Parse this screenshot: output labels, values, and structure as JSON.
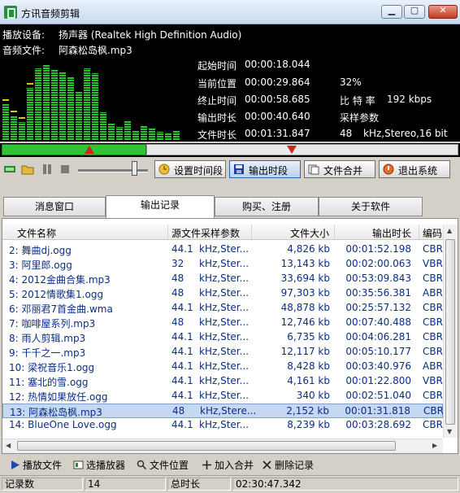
{
  "window": {
    "title": "方讯音频剪辑"
  },
  "player": {
    "device_label": "播放设备:",
    "device_value": "扬声器 (Realtek High Definition Audio)",
    "file_label": "音频文件:",
    "file_value": "阿森松岛枫.mp3",
    "start_time_label": "起始时间",
    "start_time": "00:00:18.044",
    "current_pos_label": "当前位置",
    "current_pos": "00:00:29.864",
    "end_time_label": "终止时间",
    "end_time": "00:00:58.685",
    "output_duration_label": "输出时长",
    "output_duration": "00:00:40.640",
    "file_duration_label": "文件时长",
    "file_duration": "00:01:31.847",
    "percent": "32%",
    "bitrate_label": "比 特 率",
    "bitrate_value": "192 kbps",
    "sample_label": "采样参数",
    "sample_rate": "48",
    "sample_mode": "kHz,Stereo",
    "sample_bits": ",16 bit"
  },
  "progress": {
    "fraction": 0.32
  },
  "toolbar": {
    "set_range": "设置时间段",
    "output_range": "输出时段",
    "merge_files": "文件合并",
    "exit": "退出系统"
  },
  "tabs": [
    "消息窗口",
    "输出记录",
    "购买、注册",
    "关于软件"
  ],
  "table": {
    "headers": [
      "文件名称",
      "源文件采样参数",
      "文件大小",
      "输出时长",
      "编码"
    ],
    "rows": [
      {
        "name": "2: 舞曲dj.ogg",
        "sr": "44.1",
        "mode": "kHz,Ster...",
        "size": "4,826 kb",
        "dur": "00:01:52.198",
        "enc": "CBR"
      },
      {
        "name": "3: 阿里郎.ogg",
        "sr": "32",
        "mode": "kHz,Ster...",
        "size": "13,143 kb",
        "dur": "00:02:00.063",
        "enc": "VBR"
      },
      {
        "name": "4: 2012金曲合集.mp3",
        "sr": "48",
        "mode": "kHz,Ster...",
        "size": "33,694 kb",
        "dur": "00:53:09.843",
        "enc": "CBR"
      },
      {
        "name": "5: 2012情歌集1.ogg",
        "sr": "48",
        "mode": "kHz,Ster...",
        "size": "97,303 kb",
        "dur": "00:35:56.381",
        "enc": "ABR"
      },
      {
        "name": "6: 邓丽君7首金曲.wma",
        "sr": "44.1",
        "mode": "kHz,Ster...",
        "size": "48,878 kb",
        "dur": "00:25:57.132",
        "enc": "CBR"
      },
      {
        "name": "7: 咖啡屋系列.mp3",
        "sr": "48",
        "mode": "kHz,Ster...",
        "size": "12,746 kb",
        "dur": "00:07:40.488",
        "enc": "CBR"
      },
      {
        "name": "8: 雨人剪辑.mp3",
        "sr": "44.1",
        "mode": "kHz,Ster...",
        "size": "6,735 kb",
        "dur": "00:04:06.281",
        "enc": "CBR"
      },
      {
        "name": "9: 千千之一.mp3",
        "sr": "44.1",
        "mode": "kHz,Ster...",
        "size": "12,117 kb",
        "dur": "00:05:10.177",
        "enc": "CBR"
      },
      {
        "name": "10: 梁祝音乐1.ogg",
        "sr": "44.1",
        "mode": "kHz,Ster...",
        "size": "8,428 kb",
        "dur": "00:03:40.976",
        "enc": "ABR"
      },
      {
        "name": "11: 塞北的雪.ogg",
        "sr": "44.1",
        "mode": "kHz,Ster...",
        "size": "4,161 kb",
        "dur": "00:01:22.800",
        "enc": "VBR"
      },
      {
        "name": "12: 热情如果放任.ogg",
        "sr": "44.1",
        "mode": "kHz,Ster...",
        "size": "340 kb",
        "dur": "00:02:51.040",
        "enc": "CBR"
      },
      {
        "name": "13: 阿森松岛枫.mp3",
        "sr": "48",
        "mode": "kHz,Stere...",
        "size": "2,152 kb",
        "dur": "00:01:31.818",
        "enc": "CBR"
      },
      {
        "name": "14: BlueOne Love.ogg",
        "sr": "44.1",
        "mode": "kHz,Ster...",
        "size": "8,239 kb",
        "dur": "00:03:28.692",
        "enc": "CBR"
      }
    ]
  },
  "actions": {
    "play_file": "播放文件",
    "choose_player": "选播放器",
    "file_location": "文件位置",
    "add_merge": "加入合并",
    "delete_record": "删除记录"
  },
  "status": {
    "count_label": "记录数",
    "count_value": "14",
    "total_label": "总时长",
    "total_value": "02:30:47.342"
  },
  "colors": {
    "accent_green": "#2ec435",
    "marker_red": "#d42222",
    "selection": "#c6d8f1"
  }
}
